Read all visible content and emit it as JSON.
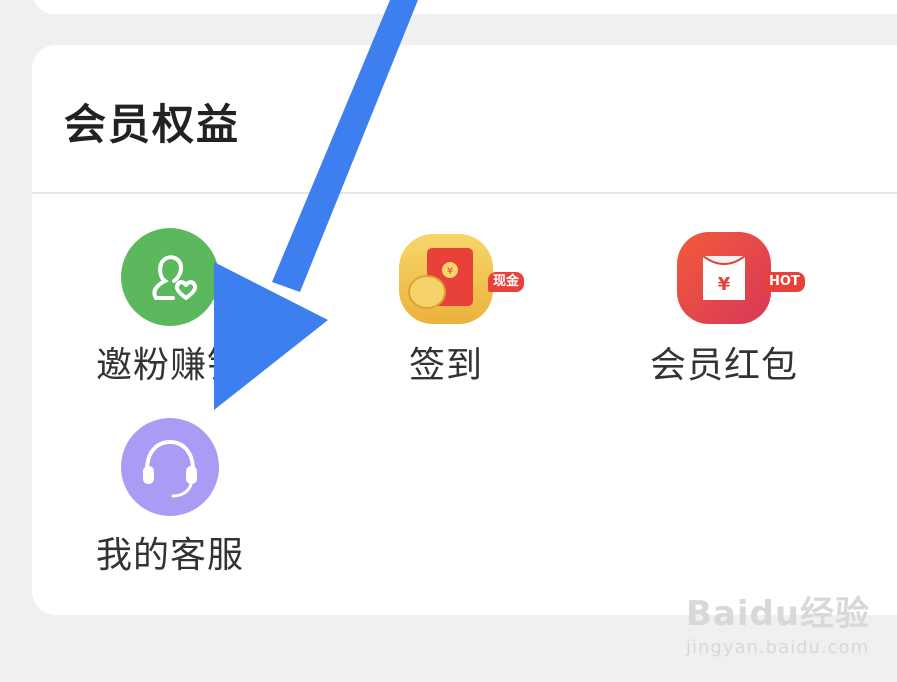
{
  "section": {
    "title": "会员权益",
    "items": [
      {
        "label": "邀粉赚钱",
        "icon": "invite-fans-icon",
        "color": "#5cb85c"
      },
      {
        "label": "签到",
        "icon": "sign-in-icon",
        "badge": "现金",
        "color": "#f2c94c"
      },
      {
        "label": "会员红包",
        "icon": "red-packet-icon",
        "badge": "HOT",
        "color": "#e2403a"
      },
      {
        "label": "我的客服",
        "icon": "customer-service-icon",
        "color": "#a99cf5"
      }
    ]
  },
  "watermark": {
    "logo": "Baidu经验",
    "url": "jingyan.baidu.com"
  },
  "colors": {
    "arrow": "#3e7ff0",
    "background": "#f0f0f0",
    "card": "#ffffff"
  }
}
